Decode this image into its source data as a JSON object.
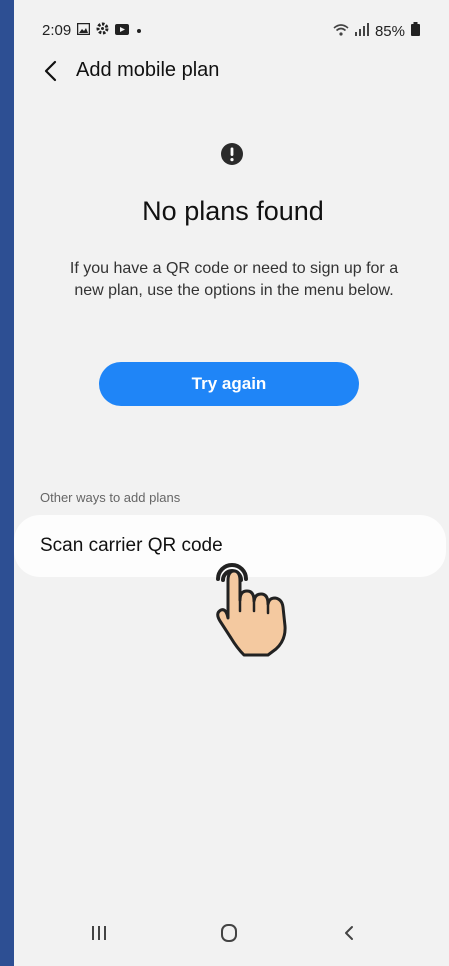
{
  "status_bar": {
    "time": "2:09",
    "battery": "85%",
    "icons": [
      "gallery-icon",
      "settings-icon",
      "video-icon",
      "dot-icon",
      "wifi-icon",
      "signal-icon",
      "battery-icon"
    ]
  },
  "header": {
    "title": "Add mobile plan"
  },
  "main": {
    "headline": "No plans found",
    "description": "If you have a QR code or need to sign up for a new plan, use the options in the menu below.",
    "try_again_label": "Try again"
  },
  "other_ways": {
    "section_label": "Other ways to add plans",
    "items": [
      {
        "label": "Scan carrier QR code"
      }
    ]
  },
  "nav_bar": {
    "icons": [
      "recent-apps-icon",
      "home-icon",
      "back-icon"
    ]
  },
  "colors": {
    "accent": "#1f85f7",
    "frame": "#2d4f93",
    "screen_bg": "#f2f2f2",
    "hand_fill": "#f4c9a0"
  }
}
